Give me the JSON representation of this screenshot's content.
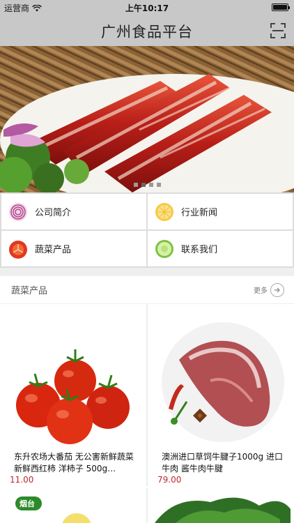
{
  "status": {
    "carrier": "运营商",
    "time": "上午10:17"
  },
  "nav": {
    "title": "广州食品平台"
  },
  "banner": {
    "dots": 4,
    "active": 1
  },
  "grid": {
    "items": [
      {
        "label": "公司简介",
        "icon": "onion-icon"
      },
      {
        "label": "行业新闻",
        "icon": "citrus-icon"
      },
      {
        "label": "蔬菜产品",
        "icon": "tomato-icon"
      },
      {
        "label": "联系我们",
        "icon": "cucumber-icon"
      }
    ]
  },
  "section": {
    "title": "蔬菜产品",
    "more": "更多",
    "products": [
      {
        "name": "东升农场大番茄 无公害新鲜蔬菜 新鲜西红柿 洋柿子 500g…",
        "price": "11.00"
      },
      {
        "name": "澳洲进口草饲牛腱子1000g 进口牛肉 酱牛肉牛腱",
        "price": "79.00"
      }
    ],
    "partial_badge": "烟台"
  },
  "colors": {
    "price": "#c1272d",
    "bar": "#c8c8c8"
  }
}
